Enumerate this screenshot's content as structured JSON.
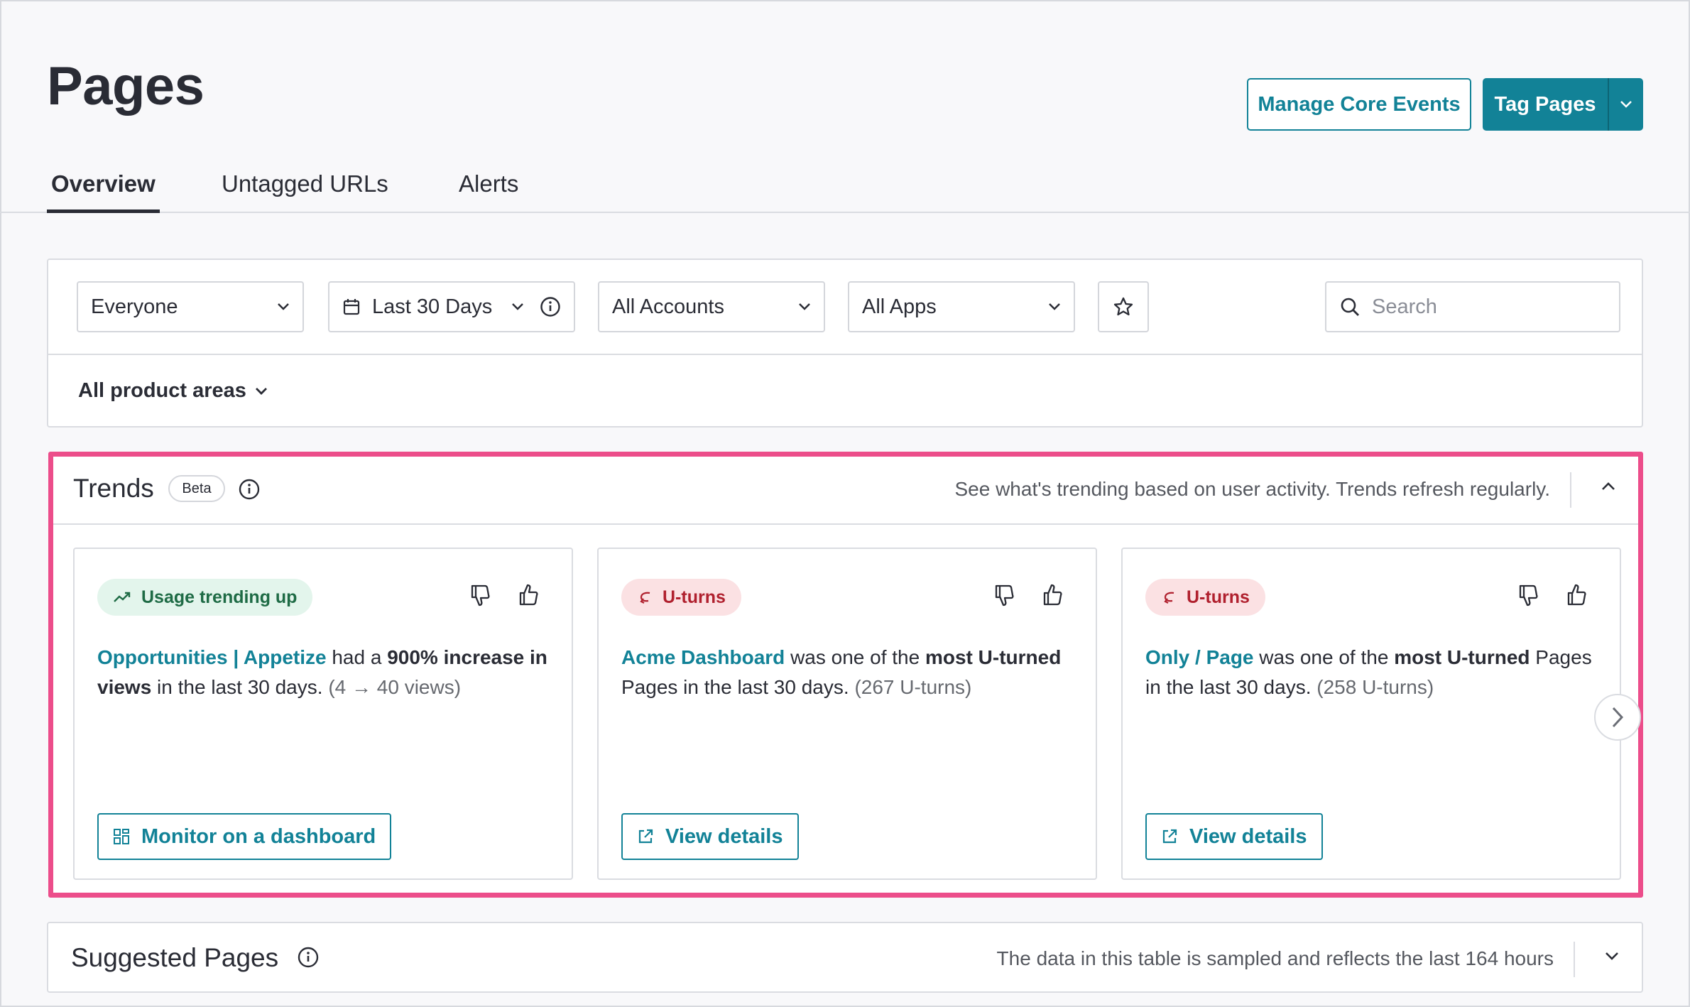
{
  "page": {
    "title": "Pages"
  },
  "header_actions": {
    "manage_label": "Manage Core Events",
    "tag_label": "Tag Pages"
  },
  "tabs": [
    {
      "label": "Overview",
      "active": true
    },
    {
      "label": "Untagged URLs",
      "active": false
    },
    {
      "label": "Alerts",
      "active": false
    }
  ],
  "filters": {
    "segment": "Everyone",
    "date_range": "Last 30 Days",
    "accounts": "All Accounts",
    "apps": "All Apps",
    "search_placeholder": "Search",
    "product_areas": "All product areas"
  },
  "trends": {
    "title": "Trends",
    "badge": "Beta",
    "description": "See what's trending based on user activity. Trends refresh regularly.",
    "cards": [
      {
        "pill": "Usage trending up",
        "pill_color": "#e3f5ec",
        "link": "Opportunities | Appetize",
        "text_a": " had a ",
        "bold_a": "900% increase in views",
        "text_b": " in the last 30 days. ",
        "muted": "(4 → 40 views)",
        "button": "Monitor on a dashboard"
      },
      {
        "pill": "U-turns",
        "pill_color": "#fbe1e3",
        "link": "Acme Dashboard",
        "text_a": " was one of the ",
        "bold_a": "most U-turned",
        "text_b": " Pages in the last 30 days. ",
        "muted": "(267 U-turns)",
        "button": "View details"
      },
      {
        "pill": "U-turns",
        "pill_color": "#fbe1e3",
        "link": "Only / Page",
        "text_a": " was one of the ",
        "bold_a": "most U-turned",
        "text_b": " Pages in the last 30 days. ",
        "muted": "(258 U-turns)",
        "button": "View details"
      }
    ]
  },
  "suggested": {
    "title": "Suggested Pages",
    "description": "The data in this table is sampled and reflects the last 164 hours"
  },
  "colors": {
    "accent": "#128297",
    "highlight_border": "#ec4d8a",
    "text": "#2a2c35"
  }
}
